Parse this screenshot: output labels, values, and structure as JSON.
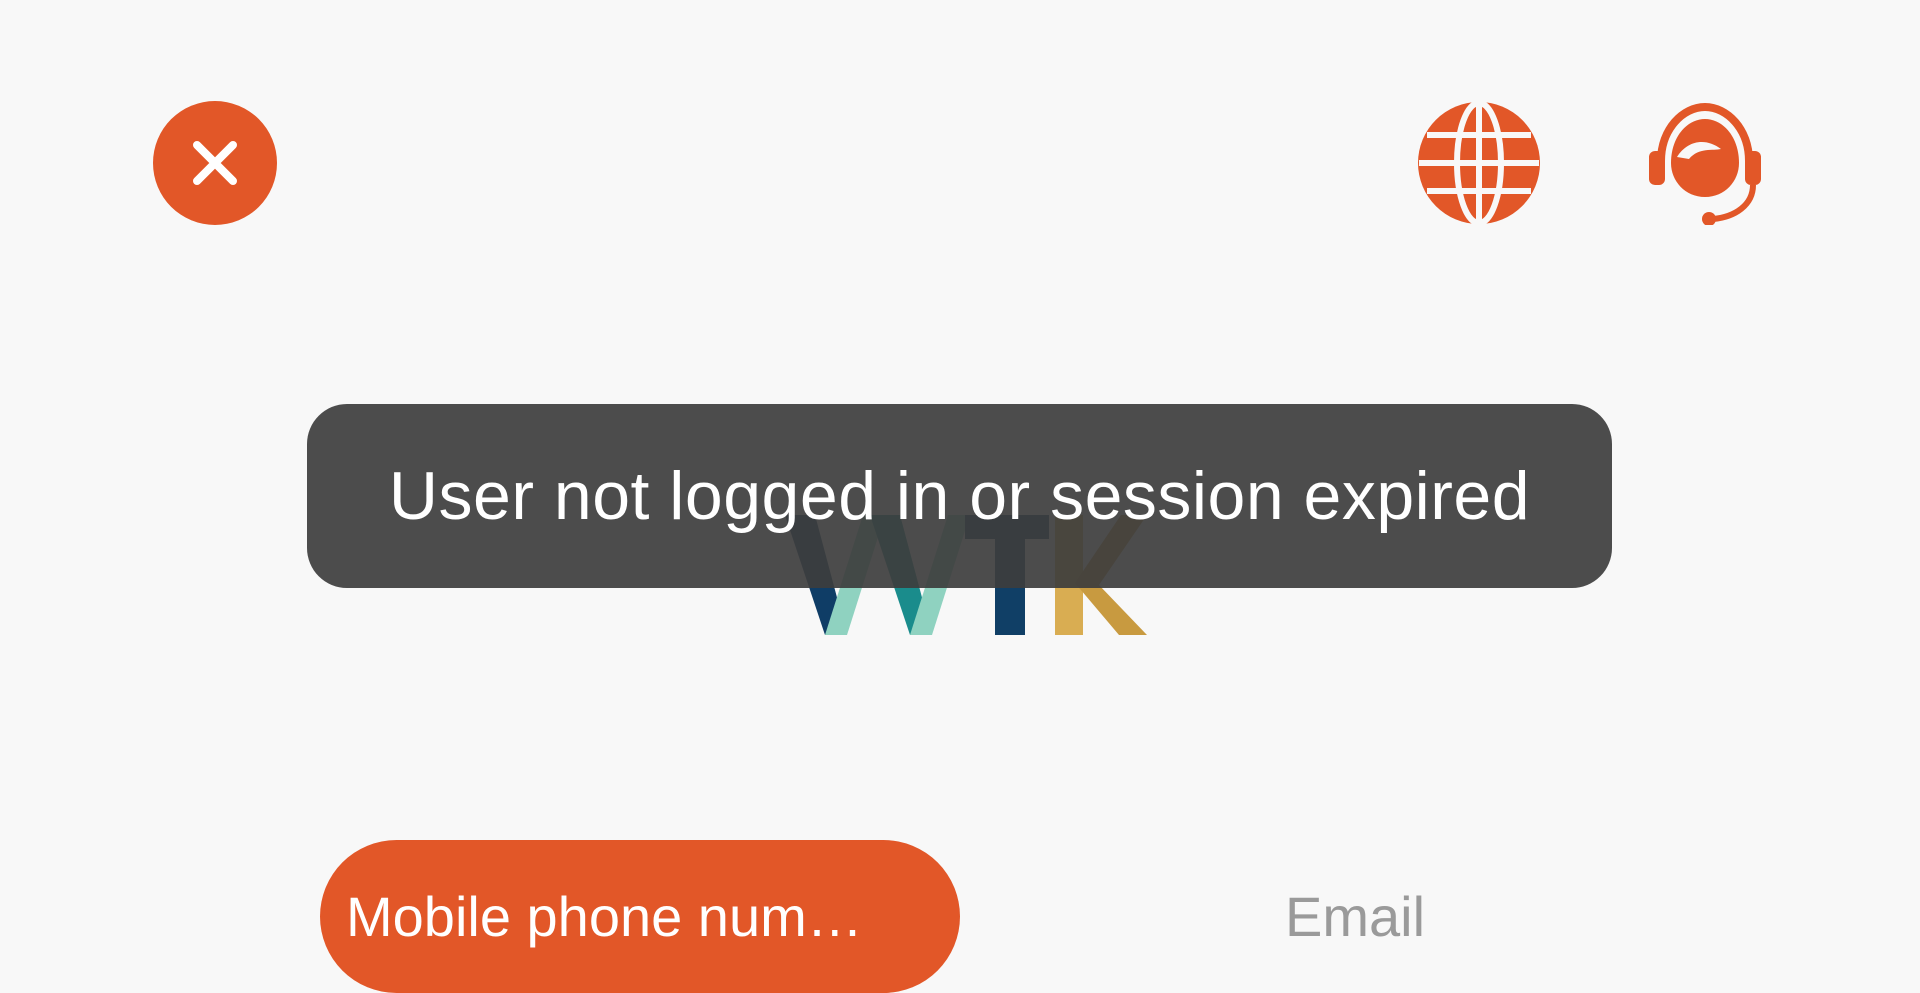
{
  "header": {
    "close_icon": "close-icon",
    "language_icon": "globe-icon",
    "support_icon": "customer-service-icon"
  },
  "logo": {
    "text": "VVITK",
    "colors": [
      "#0f3d66",
      "#8fd2c0",
      "#1a8c8c",
      "#103f66",
      "#d9ad52"
    ]
  },
  "toast": {
    "message": "User not logged in or session expired"
  },
  "login_tabs": {
    "active_label": "Mobile phone num…",
    "inactive_label": "Email"
  },
  "colors": {
    "accent": "#e25728",
    "toast_bg": "#3d3d3d",
    "inactive_text": "#9a9a9a"
  }
}
